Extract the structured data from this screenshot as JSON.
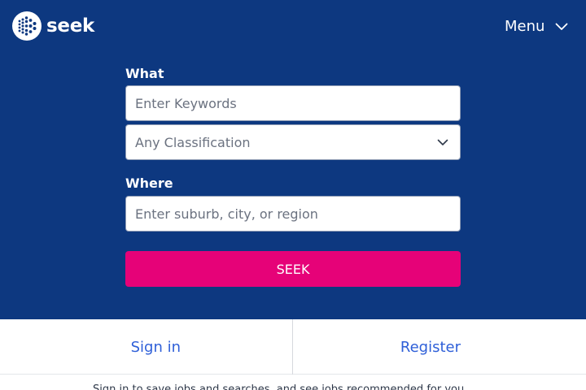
{
  "header": {
    "logo_text": "seek",
    "menu_label": "Menu"
  },
  "search": {
    "what_label": "What",
    "keywords_placeholder": "Enter Keywords",
    "classification_value": "Any Classification",
    "where_label": "Where",
    "where_placeholder": "Enter suburb, city, or region",
    "submit_label": "SEEK"
  },
  "auth": {
    "sign_in_label": "Sign in",
    "register_label": "Register"
  },
  "footer": {
    "note": "Sign in to save jobs and searches, and see jobs recommended for you"
  },
  "colors": {
    "hero_background": "#0d3880",
    "accent_pink": "#e60278",
    "link_blue": "#2e5fd8"
  },
  "icons": {
    "logo": "seek-dot-logo-icon",
    "menu": "chevron-down-icon",
    "select": "chevron-down-icon"
  }
}
